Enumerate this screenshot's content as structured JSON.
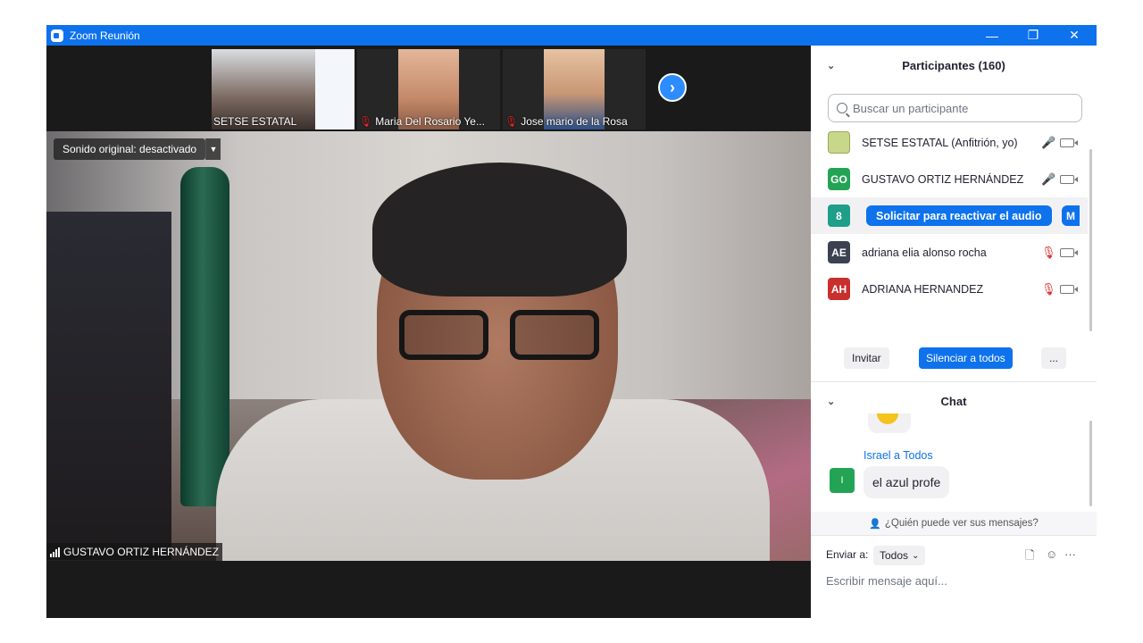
{
  "window": {
    "title": "Zoom Reunión",
    "minimize_glyph": "—",
    "maximize_glyph": "❐",
    "close_glyph": "✕"
  },
  "video": {
    "thumbnails": [
      {
        "name": "SETSE ESTATAL",
        "muted": false
      },
      {
        "name": "Maria Del Rosario Ye...",
        "muted": true
      },
      {
        "name": "Jose mario de la Rosa",
        "muted": true
      }
    ],
    "next_arrow": "›",
    "sound_label": "Sonido original: desactivado",
    "sound_drop_glyph": "▼",
    "active_speaker": "GUSTAVO ORTIZ HERNÁNDEZ"
  },
  "participants": {
    "header": "Participantes (160)",
    "collapse_glyph": "⌄",
    "search_placeholder": "Buscar un participante",
    "list": [
      {
        "avatar": "",
        "avatar_color": "#c8d88a",
        "name": "SETSE ESTATAL (Anfitrión, yo)",
        "mic": "on"
      },
      {
        "avatar": "GO",
        "avatar_color": "#23a454",
        "name": "GUSTAVO ORTIZ HERNÁNDEZ",
        "mic": "on"
      },
      {
        "avatar": "8",
        "avatar_color": "#1f9e8a",
        "name": "",
        "mic": "action"
      },
      {
        "avatar": "AE",
        "avatar_color": "#3b4150",
        "name": "adriana elia alonso rocha",
        "mic": "off"
      },
      {
        "avatar": "AH",
        "avatar_color": "#c8302d",
        "name": "ADRIANA HERNANDEZ",
        "mic": "off"
      }
    ],
    "reactivate_label": "Solicitar para reactivar el audio",
    "more_cut_label": "M",
    "mic_glyph": "🎤",
    "mic_off_glyph": "🎙",
    "invite_label": "Invitar",
    "mute_all_label": "Silenciar a todos",
    "more_label": "..."
  },
  "chat": {
    "header": "Chat",
    "collapse_glyph": "⌄",
    "message": {
      "sender": "Israel a Todos",
      "avatar": "I",
      "text": "el azul profe"
    },
    "who_sees": "¿Quién puede ver sus mensajes?",
    "who_sees_glyph": "👤",
    "send_to_label": "Enviar a:",
    "destination": "Todos",
    "destination_glyph": "⌄",
    "file_glyph": "🗋",
    "emoji_glyph": "☺",
    "more_glyph": "···",
    "input_placeholder": "Escribir mensaje aquí..."
  }
}
